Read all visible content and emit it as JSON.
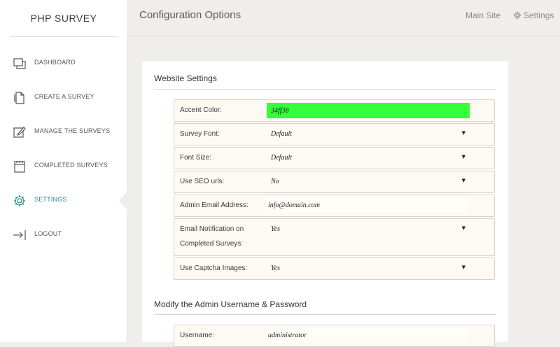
{
  "sidebar": {
    "brand": "PHP SURVEY",
    "items": [
      {
        "label": "DASHBOARD",
        "icon": "dashboard-icon"
      },
      {
        "label": "CREATE A SURVEY",
        "icon": "create-survey-icon"
      },
      {
        "label": "MANAGE THE SURVEYS",
        "icon": "edit-icon"
      },
      {
        "label": "COMPLETED SURVEYS",
        "icon": "calendar-icon"
      },
      {
        "label": "SETTINGS",
        "icon": "gear-icon",
        "active": true,
        "accent": "#2a8a8a"
      },
      {
        "label": "LOGOUT",
        "icon": "logout-icon"
      }
    ]
  },
  "header": {
    "title": "Configuration Options",
    "main_site": "Main Site",
    "settings": "Settings"
  },
  "website_settings": {
    "title": "Website Settings",
    "accent_color": {
      "label": "Accent Color:",
      "value": "34ff38",
      "swatch": "#34ff38"
    },
    "survey_font": {
      "label": "Survey Font:",
      "value": "Default"
    },
    "font_size": {
      "label": "Font Size:",
      "value": "Default"
    },
    "seo_urls": {
      "label": "Use SEO urls:",
      "value": "No"
    },
    "admin_email": {
      "label": "Admin Email Address:",
      "value": "info@domain.com"
    },
    "email_notification": {
      "label_line1": "Email Notification on",
      "label_line2": "Completed Surveys:",
      "value": "Yes"
    },
    "captcha": {
      "label": "Use Captcha Images:",
      "value": "Yes"
    }
  },
  "admin_credentials": {
    "title": "Modify the Admin Username & Password",
    "username": {
      "label": "Username:",
      "value": "administrator"
    }
  },
  "colors": {
    "accent": "#34ff38",
    "sidebar_active": "#2a8a8a"
  }
}
